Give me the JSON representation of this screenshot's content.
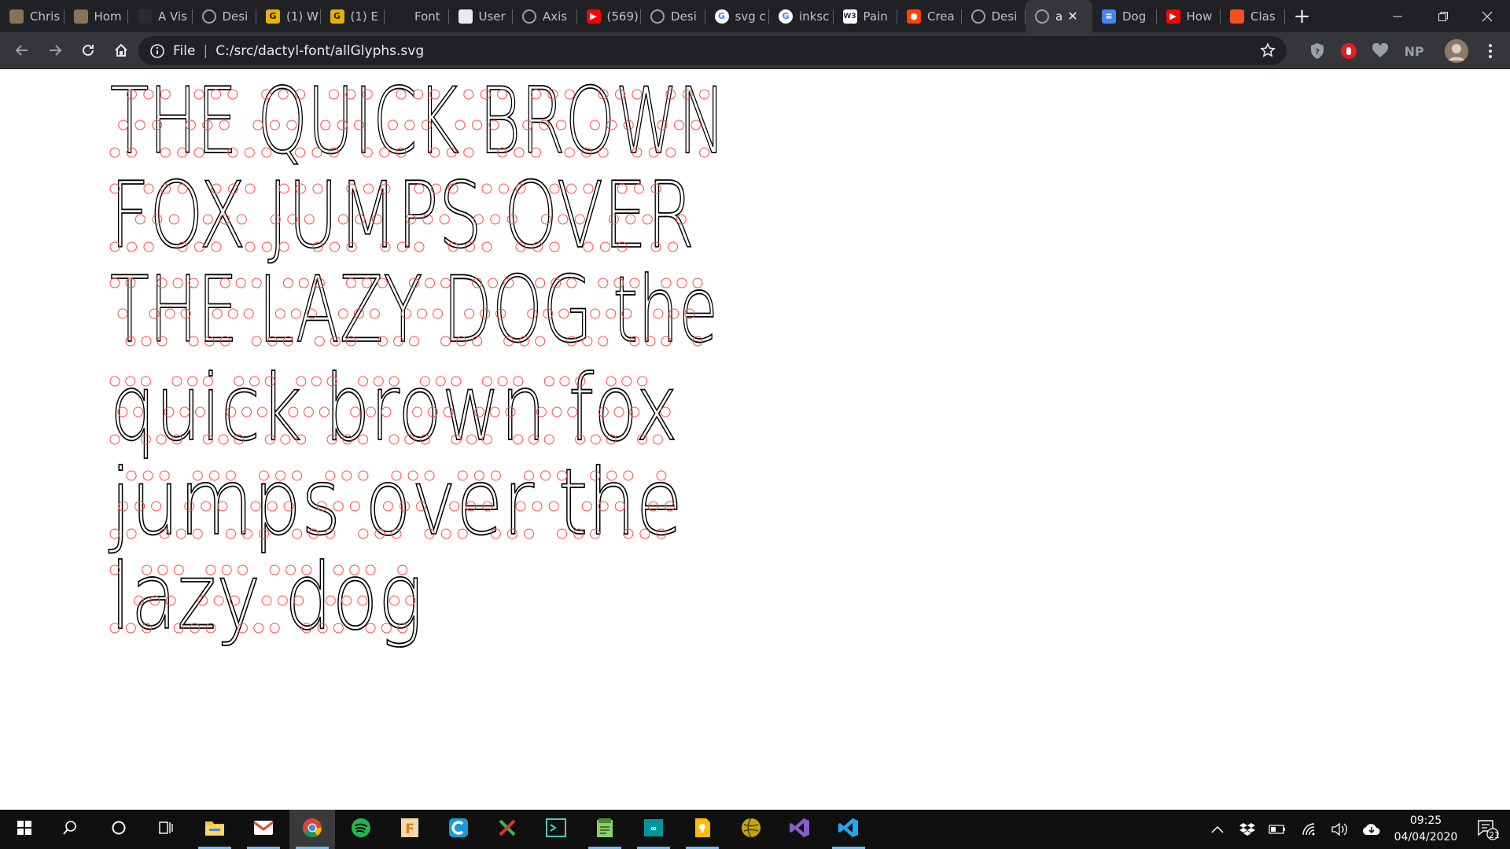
{
  "tabs": [
    {
      "title": "Chris",
      "icon": "avatar-image-icon",
      "color": "#8a7355"
    },
    {
      "title": "Hom",
      "icon": "avatar-image-icon",
      "color": "#8a7355"
    },
    {
      "title": "A Vis",
      "icon": "dark-circle-icon",
      "color": "#2b2b2b"
    },
    {
      "title": "Desi",
      "icon": "globe-icon",
      "color": "#9aa0a6"
    },
    {
      "title": "(1) W",
      "icon": "g-letter-icon",
      "color": "#e6b300"
    },
    {
      "title": "(1) E",
      "icon": "g-letter-icon",
      "color": "#e6b300"
    },
    {
      "title": "Font",
      "icon": "sliders-icon",
      "color": "#9aa0a6"
    },
    {
      "title": "User",
      "icon": "grid-logo-icon",
      "color": "#e8eaed"
    },
    {
      "title": "Axis",
      "icon": "globe-icon",
      "color": "#9aa0a6"
    },
    {
      "title": "(569)",
      "icon": "youtube-icon",
      "color": "#ff0000"
    },
    {
      "title": "Desi",
      "icon": "globe-icon",
      "color": "#9aa0a6"
    },
    {
      "title": "svg c",
      "icon": "google-icon",
      "color": "#4285f4"
    },
    {
      "title": "inksc",
      "icon": "google-icon",
      "color": "#4285f4"
    },
    {
      "title": "Pain",
      "icon": "w3schools-icon",
      "color": "#ffffff"
    },
    {
      "title": "Crea",
      "icon": "reddit-icon",
      "color": "#ff4500"
    },
    {
      "title": "Desi",
      "icon": "globe-icon",
      "color": "#9aa0a6"
    },
    {
      "title": "a",
      "icon": "globe-icon",
      "color": "#9aa0a6",
      "active": true
    },
    {
      "title": "Dog",
      "icon": "google-docs-icon",
      "color": "#4285f4"
    },
    {
      "title": "How",
      "icon": "youtube-icon",
      "color": "#ff0000"
    },
    {
      "title": "Clas",
      "icon": "microsoft-icon",
      "color": "#f25022"
    }
  ],
  "toolbar": {
    "scheme": "File",
    "url": "C:/src/dactyl-font/allGlyphs.svg",
    "profile_initials": "NP"
  },
  "glyph_lines": [
    "THE QUICK BROWN",
    "FOX JUMPS OVER",
    "THE LAZY DOG the",
    "quick brown fox",
    "jumps over the",
    "lazy dog"
  ],
  "taskbar": {
    "apps": [
      "windows-start-icon",
      "search-icon",
      "cortana-icon",
      "task-view-icon",
      "file-explorer-icon",
      "gmail-icon",
      "chrome-icon",
      "spotify-icon",
      "fontforge-icon",
      "ccleaner-icon",
      "crossover-icon",
      "terminal-icon",
      "notepad-icon",
      "arduino-icon",
      "keep-icon",
      "globe-app-icon",
      "visual-studio-icon",
      "vscode-icon"
    ],
    "time": "09:25",
    "date": "04/04/2020",
    "notification_count": "21"
  },
  "colors": {
    "tab_bg": "#202124",
    "toolbar_bg": "#35363a",
    "glyph_stroke": "#000000",
    "node_stroke": "#ff4d4d"
  }
}
